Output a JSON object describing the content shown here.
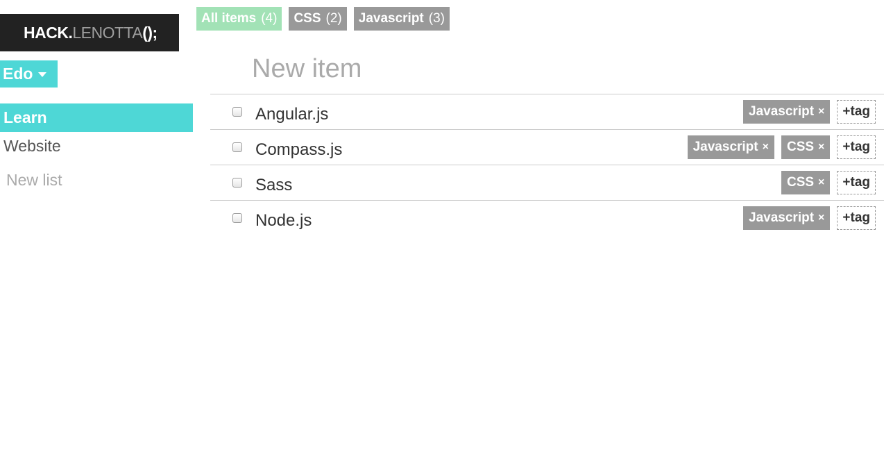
{
  "logo": {
    "part1": "HACK.",
    "part2": "LENOTTA",
    "part3": "();"
  },
  "user": {
    "name": "Edo"
  },
  "lists": [
    {
      "label": "Learn",
      "active": true
    },
    {
      "label": "Website",
      "active": false
    }
  ],
  "new_list_label": "New list",
  "filters": [
    {
      "label": "All items",
      "count": "(4)",
      "active": true
    },
    {
      "label": "CSS",
      "count": "(2)",
      "active": false
    },
    {
      "label": "Javascript",
      "count": "(3)",
      "active": false
    }
  ],
  "new_item": {
    "placeholder": "New item"
  },
  "items": [
    {
      "title": "Angular.js",
      "tags": [
        "Javascript"
      ]
    },
    {
      "title": "Compass.js",
      "tags": [
        "Javascript",
        "CSS"
      ]
    },
    {
      "title": "Sass",
      "tags": [
        "CSS"
      ]
    },
    {
      "title": "Node.js",
      "tags": [
        "Javascript"
      ]
    }
  ],
  "tag_remove_symbol": "×",
  "add_tag_label": "+tag",
  "colors": {
    "accent": "#4ed7d6",
    "filter_active": "#a2e2b6",
    "tag_bg": "#999999",
    "logo_bg": "#222222"
  }
}
